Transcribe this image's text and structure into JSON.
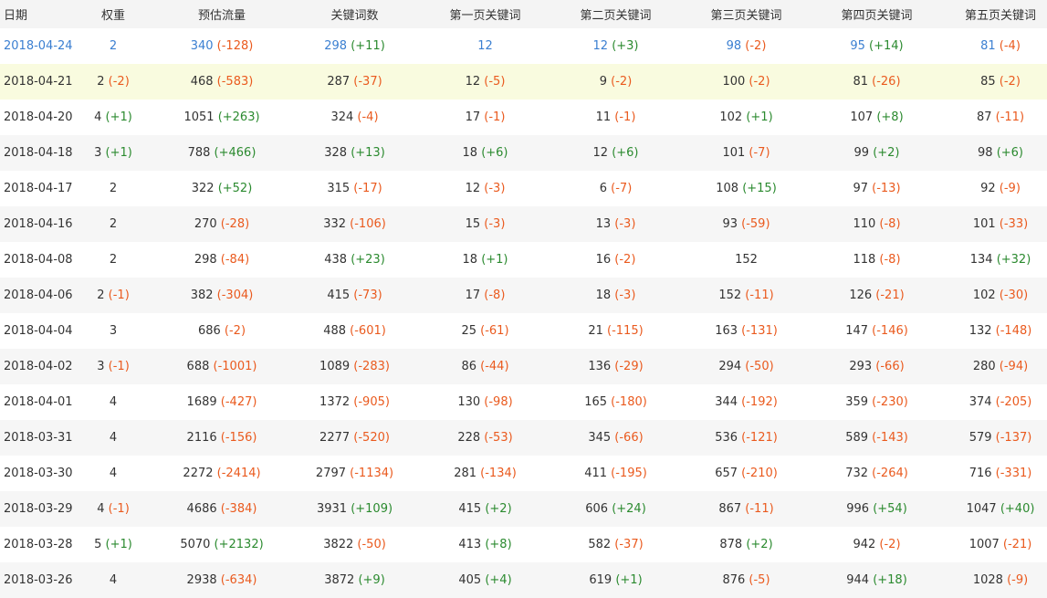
{
  "table": {
    "headers": [
      "日期",
      "权重",
      "预估流量",
      "关键词数",
      "第一页关键词",
      "第二页关键词",
      "第三页关键词",
      "第四页关键词",
      "第五页关键词"
    ],
    "rows": [
      {
        "highlight": "latest",
        "cells": [
          [
            "2018-04-24",
            ""
          ],
          [
            "2",
            ""
          ],
          [
            "340",
            "(-128)"
          ],
          [
            "298",
            "(+11)"
          ],
          [
            "12",
            ""
          ],
          [
            "12",
            "(+3)"
          ],
          [
            "98",
            "(-2)"
          ],
          [
            "95",
            "(+14)"
          ],
          [
            "81",
            "(-4)"
          ]
        ]
      },
      {
        "highlight": "yellow",
        "cells": [
          [
            "2018-04-21",
            ""
          ],
          [
            "2",
            "(-2)"
          ],
          [
            "468",
            "(-583)"
          ],
          [
            "287",
            "(-37)"
          ],
          [
            "12",
            "(-5)"
          ],
          [
            "9",
            "(-2)"
          ],
          [
            "100",
            "(-2)"
          ],
          [
            "81",
            "(-26)"
          ],
          [
            "85",
            "(-2)"
          ]
        ]
      },
      {
        "highlight": "",
        "cells": [
          [
            "2018-04-20",
            ""
          ],
          [
            "4",
            "(+1)"
          ],
          [
            "1051",
            "(+263)"
          ],
          [
            "324",
            "(-4)"
          ],
          [
            "17",
            "(-1)"
          ],
          [
            "11",
            "(-1)"
          ],
          [
            "102",
            "(+1)"
          ],
          [
            "107",
            "(+8)"
          ],
          [
            "87",
            "(-11)"
          ]
        ]
      },
      {
        "highlight": "",
        "cells": [
          [
            "2018-04-18",
            ""
          ],
          [
            "3",
            "(+1)"
          ],
          [
            "788",
            "(+466)"
          ],
          [
            "328",
            "(+13)"
          ],
          [
            "18",
            "(+6)"
          ],
          [
            "12",
            "(+6)"
          ],
          [
            "101",
            "(-7)"
          ],
          [
            "99",
            "(+2)"
          ],
          [
            "98",
            "(+6)"
          ]
        ]
      },
      {
        "highlight": "",
        "cells": [
          [
            "2018-04-17",
            ""
          ],
          [
            "2",
            ""
          ],
          [
            "322",
            "(+52)"
          ],
          [
            "315",
            "(-17)"
          ],
          [
            "12",
            "(-3)"
          ],
          [
            "6",
            "(-7)"
          ],
          [
            "108",
            "(+15)"
          ],
          [
            "97",
            "(-13)"
          ],
          [
            "92",
            "(-9)"
          ]
        ]
      },
      {
        "highlight": "",
        "cells": [
          [
            "2018-04-16",
            ""
          ],
          [
            "2",
            ""
          ],
          [
            "270",
            "(-28)"
          ],
          [
            "332",
            "(-106)"
          ],
          [
            "15",
            "(-3)"
          ],
          [
            "13",
            "(-3)"
          ],
          [
            "93",
            "(-59)"
          ],
          [
            "110",
            "(-8)"
          ],
          [
            "101",
            "(-33)"
          ]
        ]
      },
      {
        "highlight": "",
        "cells": [
          [
            "2018-04-08",
            ""
          ],
          [
            "2",
            ""
          ],
          [
            "298",
            "(-84)"
          ],
          [
            "438",
            "(+23)"
          ],
          [
            "18",
            "(+1)"
          ],
          [
            "16",
            "(-2)"
          ],
          [
            "152",
            ""
          ],
          [
            "118",
            "(-8)"
          ],
          [
            "134",
            "(+32)"
          ]
        ]
      },
      {
        "highlight": "",
        "cells": [
          [
            "2018-04-06",
            ""
          ],
          [
            "2",
            "(-1)"
          ],
          [
            "382",
            "(-304)"
          ],
          [
            "415",
            "(-73)"
          ],
          [
            "17",
            "(-8)"
          ],
          [
            "18",
            "(-3)"
          ],
          [
            "152",
            "(-11)"
          ],
          [
            "126",
            "(-21)"
          ],
          [
            "102",
            "(-30)"
          ]
        ]
      },
      {
        "highlight": "",
        "cells": [
          [
            "2018-04-04",
            ""
          ],
          [
            "3",
            ""
          ],
          [
            "686",
            "(-2)"
          ],
          [
            "488",
            "(-601)"
          ],
          [
            "25",
            "(-61)"
          ],
          [
            "21",
            "(-115)"
          ],
          [
            "163",
            "(-131)"
          ],
          [
            "147",
            "(-146)"
          ],
          [
            "132",
            "(-148)"
          ]
        ]
      },
      {
        "highlight": "",
        "cells": [
          [
            "2018-04-02",
            ""
          ],
          [
            "3",
            "(-1)"
          ],
          [
            "688",
            "(-1001)"
          ],
          [
            "1089",
            "(-283)"
          ],
          [
            "86",
            "(-44)"
          ],
          [
            "136",
            "(-29)"
          ],
          [
            "294",
            "(-50)"
          ],
          [
            "293",
            "(-66)"
          ],
          [
            "280",
            "(-94)"
          ]
        ]
      },
      {
        "highlight": "",
        "cells": [
          [
            "2018-04-01",
            ""
          ],
          [
            "4",
            ""
          ],
          [
            "1689",
            "(-427)"
          ],
          [
            "1372",
            "(-905)"
          ],
          [
            "130",
            "(-98)"
          ],
          [
            "165",
            "(-180)"
          ],
          [
            "344",
            "(-192)"
          ],
          [
            "359",
            "(-230)"
          ],
          [
            "374",
            "(-205)"
          ]
        ]
      },
      {
        "highlight": "",
        "cells": [
          [
            "2018-03-31",
            ""
          ],
          [
            "4",
            ""
          ],
          [
            "2116",
            "(-156)"
          ],
          [
            "2277",
            "(-520)"
          ],
          [
            "228",
            "(-53)"
          ],
          [
            "345",
            "(-66)"
          ],
          [
            "536",
            "(-121)"
          ],
          [
            "589",
            "(-143)"
          ],
          [
            "579",
            "(-137)"
          ]
        ]
      },
      {
        "highlight": "",
        "cells": [
          [
            "2018-03-30",
            ""
          ],
          [
            "4",
            ""
          ],
          [
            "2272",
            "(-2414)"
          ],
          [
            "2797",
            "(-1134)"
          ],
          [
            "281",
            "(-134)"
          ],
          [
            "411",
            "(-195)"
          ],
          [
            "657",
            "(-210)"
          ],
          [
            "732",
            "(-264)"
          ],
          [
            "716",
            "(-331)"
          ]
        ]
      },
      {
        "highlight": "",
        "cells": [
          [
            "2018-03-29",
            ""
          ],
          [
            "4",
            "(-1)"
          ],
          [
            "4686",
            "(-384)"
          ],
          [
            "3931",
            "(+109)"
          ],
          [
            "415",
            "(+2)"
          ],
          [
            "606",
            "(+24)"
          ],
          [
            "867",
            "(-11)"
          ],
          [
            "996",
            "(+54)"
          ],
          [
            "1047",
            "(+40)"
          ]
        ]
      },
      {
        "highlight": "",
        "cells": [
          [
            "2018-03-28",
            ""
          ],
          [
            "5",
            "(+1)"
          ],
          [
            "5070",
            "(+2132)"
          ],
          [
            "3822",
            "(-50)"
          ],
          [
            "413",
            "(+8)"
          ],
          [
            "582",
            "(-37)"
          ],
          [
            "878",
            "(+2)"
          ],
          [
            "942",
            "(-2)"
          ],
          [
            "1007",
            "(-21)"
          ]
        ]
      },
      {
        "highlight": "",
        "cells": [
          [
            "2018-03-26",
            ""
          ],
          [
            "4",
            ""
          ],
          [
            "2938",
            "(-634)"
          ],
          [
            "3872",
            "(+9)"
          ],
          [
            "405",
            "(+4)"
          ],
          [
            "619",
            "(+1)"
          ],
          [
            "876",
            "(-5)"
          ],
          [
            "944",
            "(+18)"
          ],
          [
            "1028",
            "(-9)"
          ]
        ]
      }
    ]
  },
  "colors": {
    "header_bg": "#f4f4f4",
    "highlight_row_bg": "#f9fbdf",
    "latest_row_text": "#3b7fd1",
    "increase": "#2b8a2f",
    "decrease": "#ea5a1e"
  }
}
